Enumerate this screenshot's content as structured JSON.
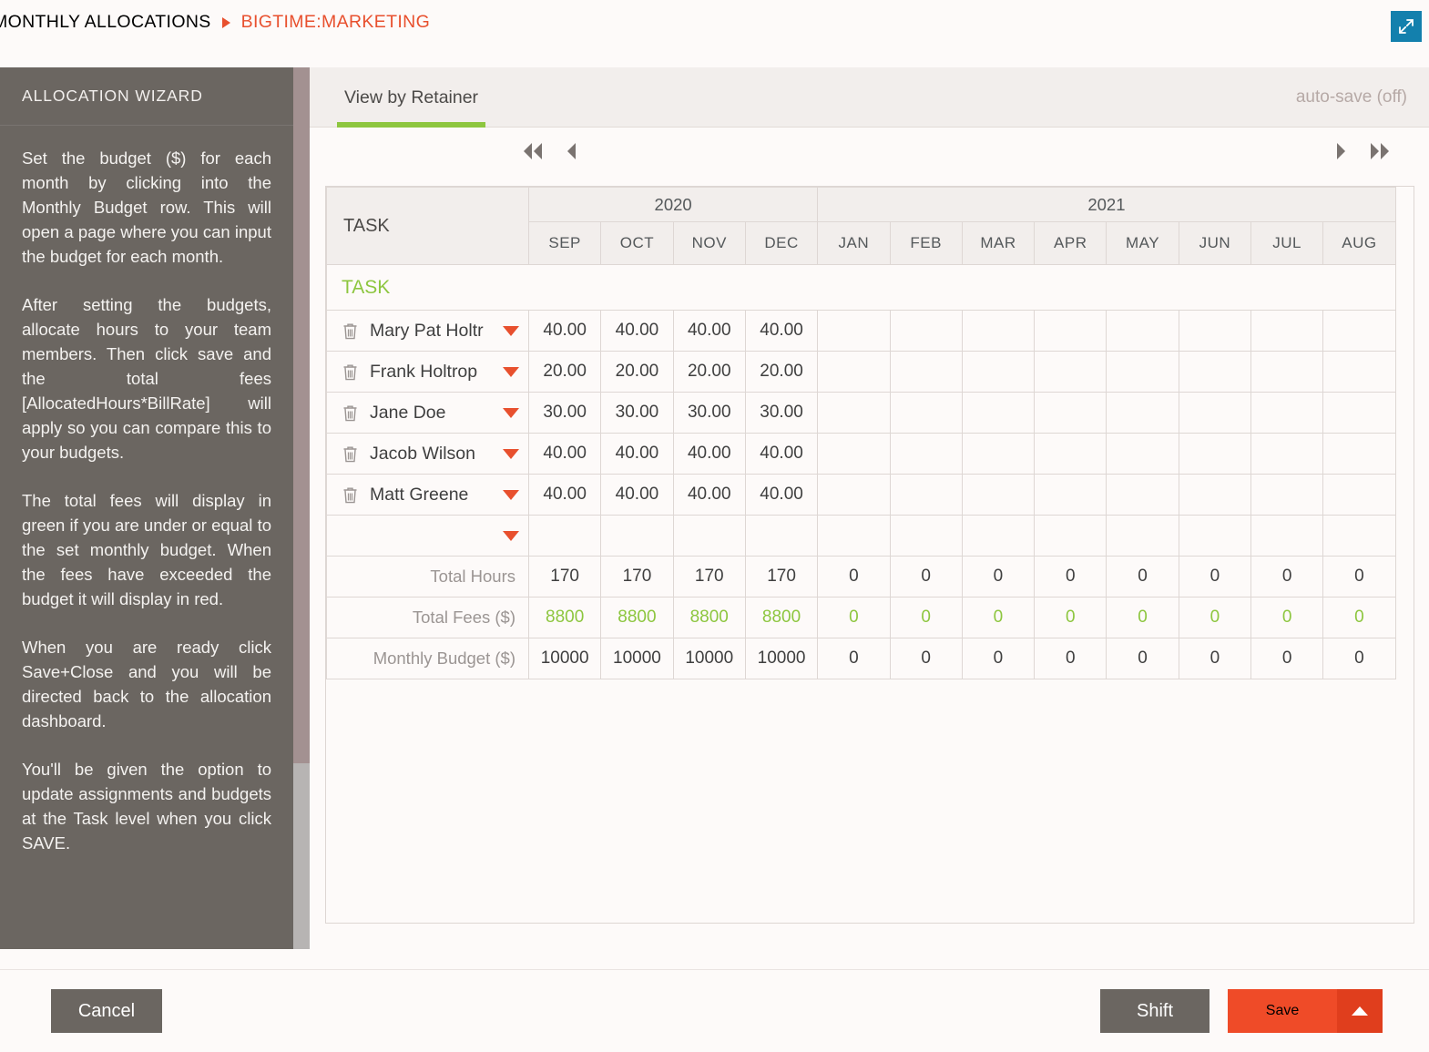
{
  "breadcrumb": {
    "parent": "MONTHLY ALLOCATIONS",
    "separator_icon": "triangle-right-icon",
    "current": "BIGTIME:MARKETING"
  },
  "topbar": {
    "expand_icon": "expand-arrows-icon",
    "expand_color": "#1380ad"
  },
  "sidebar": {
    "title": "ALLOCATION WIZARD",
    "paragraphs": [
      "Set the budget ($) for each month by clicking into the Monthly Budget row. This will open a page where you can input the budget for each month.",
      "After setting the budgets, allocate hours to your team members. Then click save and the total fees [AllocatedHours*BillRate] will apply so you can compare this to your budgets.",
      "The total fees will display in green if you are under or equal to the set monthly budget. When the fees have exceeded the budget it will display in red.",
      "When you are ready click Save+Close and you will be directed back to the allocation dashboard.",
      "You'll be given the option to update assignments and budgets at the Task level when you click SAVE."
    ]
  },
  "main": {
    "tab_label": "View by Retainer",
    "autosave_label": "auto-save (off)",
    "nav": {
      "first_icon": "double-chevron-left-icon",
      "prev_icon": "chevron-left-icon",
      "next_icon": "chevron-right-icon",
      "last_icon": "double-chevron-right-icon"
    }
  },
  "grid": {
    "task_column_header": "TASK",
    "year_groups": [
      {
        "year": "2020",
        "months": [
          "SEP",
          "OCT",
          "NOV",
          "DEC"
        ]
      },
      {
        "year": "2021",
        "months": [
          "JAN",
          "FEB",
          "MAR",
          "APR",
          "MAY",
          "JUN",
          "JUL",
          "AUG"
        ]
      }
    ],
    "group_row_label": "TASK",
    "row_icons": {
      "delete": "trash-icon",
      "dropdown": "caret-down-icon"
    },
    "rows": [
      {
        "name": "Mary Pat Holtr",
        "values": [
          "40.00",
          "40.00",
          "40.00",
          "40.00",
          "",
          "",
          "",
          "",
          "",
          "",
          "",
          ""
        ]
      },
      {
        "name": "Frank Holtrop",
        "values": [
          "20.00",
          "20.00",
          "20.00",
          "20.00",
          "",
          "",
          "",
          "",
          "",
          "",
          "",
          ""
        ]
      },
      {
        "name": "Jane Doe",
        "values": [
          "30.00",
          "30.00",
          "30.00",
          "30.00",
          "",
          "",
          "",
          "",
          "",
          "",
          "",
          ""
        ]
      },
      {
        "name": "Jacob Wilson",
        "values": [
          "40.00",
          "40.00",
          "40.00",
          "40.00",
          "",
          "",
          "",
          "",
          "",
          "",
          "",
          ""
        ]
      },
      {
        "name": "Matt Greene",
        "values": [
          "40.00",
          "40.00",
          "40.00",
          "40.00",
          "",
          "",
          "",
          "",
          "",
          "",
          "",
          ""
        ]
      },
      {
        "name": "",
        "values": [
          "",
          "",
          "",
          "",
          "",
          "",
          "",
          "",
          "",
          "",
          "",
          ""
        ]
      }
    ],
    "totals": [
      {
        "label": "Total Hours",
        "values": [
          "170",
          "170",
          "170",
          "170",
          "0",
          "0",
          "0",
          "0",
          "0",
          "0",
          "0",
          "0"
        ],
        "green": false
      },
      {
        "label": "Total Fees ($)",
        "values": [
          "8800",
          "8800",
          "8800",
          "8800",
          "0",
          "0",
          "0",
          "0",
          "0",
          "0",
          "0",
          "0"
        ],
        "green": true
      },
      {
        "label": "Monthly Budget ($)",
        "values": [
          "10000",
          "10000",
          "10000",
          "10000",
          "0",
          "0",
          "0",
          "0",
          "0",
          "0",
          "0",
          "0"
        ],
        "green": false
      }
    ]
  },
  "footer": {
    "cancel_label": "Cancel",
    "shift_label": "Shift",
    "save_label": "Save",
    "save_caret_icon": "caret-up-icon"
  },
  "colors": {
    "accent_red": "#ef4b28",
    "accent_green": "#8dc63f",
    "sidebar_bg": "#6b6661",
    "expand_blue": "#1380ad"
  }
}
